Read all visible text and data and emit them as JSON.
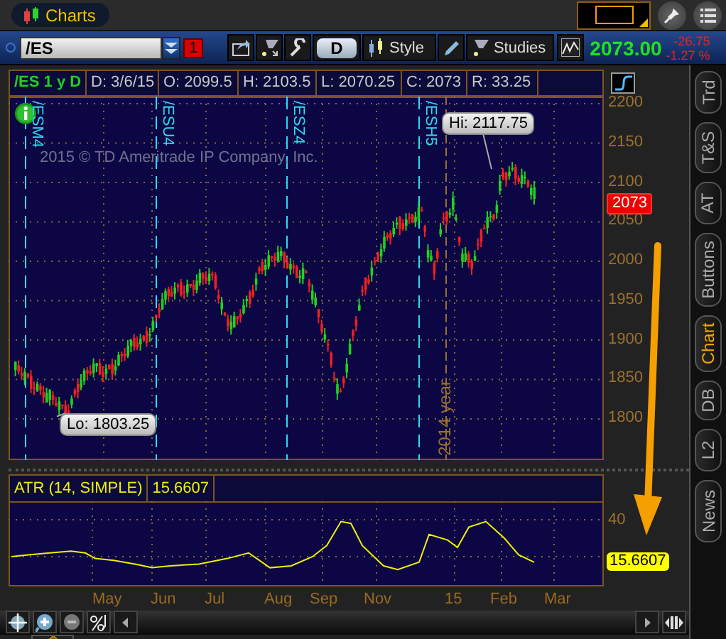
{
  "window": {
    "title": "Charts"
  },
  "toolbar": {
    "symbol": "/ES",
    "link_badge": "1",
    "period_button": "D",
    "style_button": "Style",
    "studies_button": "Studies",
    "last_price": "2073.00",
    "change": "-26.75",
    "change_percent": "-1.27 %"
  },
  "info_bar": [
    "/ES 1 y D",
    "D: 3/6/15",
    "O: 2099.5",
    "H: 2103.5",
    "L: 2070.25",
    "C: 2073",
    "R: 33.25"
  ],
  "price_chart": {
    "copyright": "2015 © TD Ameritrade IP Company, Inc.",
    "y_ticks": [
      "2200",
      "2150",
      "2100",
      "2050",
      "2000",
      "1950",
      "1900",
      "1850",
      "1800"
    ],
    "last_badge": "2073",
    "hi_label": "Hi: 2117.75",
    "lo_label": "Lo: 1803.25",
    "expiry_markers": [
      "/ESM4",
      "/ESU4",
      "/ESZ4",
      "/ESH5"
    ],
    "year_marker": "2014 year"
  },
  "study": {
    "name": "ATR (14, SIMPLE)",
    "value": "15.6607",
    "y_tick": "40",
    "value_badge": "15.6607"
  },
  "x_axis": [
    "May",
    "Jun",
    "Jul",
    "Aug",
    "Sep",
    "Nov",
    "15",
    "Feb",
    "Mar"
  ],
  "side_tabs": [
    {
      "label": "Trd",
      "selected": false
    },
    {
      "label": "T&S",
      "selected": false
    },
    {
      "label": "AT",
      "selected": false
    },
    {
      "label": "Buttons",
      "selected": false
    },
    {
      "label": "Chart",
      "selected": true
    },
    {
      "label": "DB",
      "selected": false
    },
    {
      "label": "L2",
      "selected": false
    },
    {
      "label": "News",
      "selected": false
    }
  ]
}
